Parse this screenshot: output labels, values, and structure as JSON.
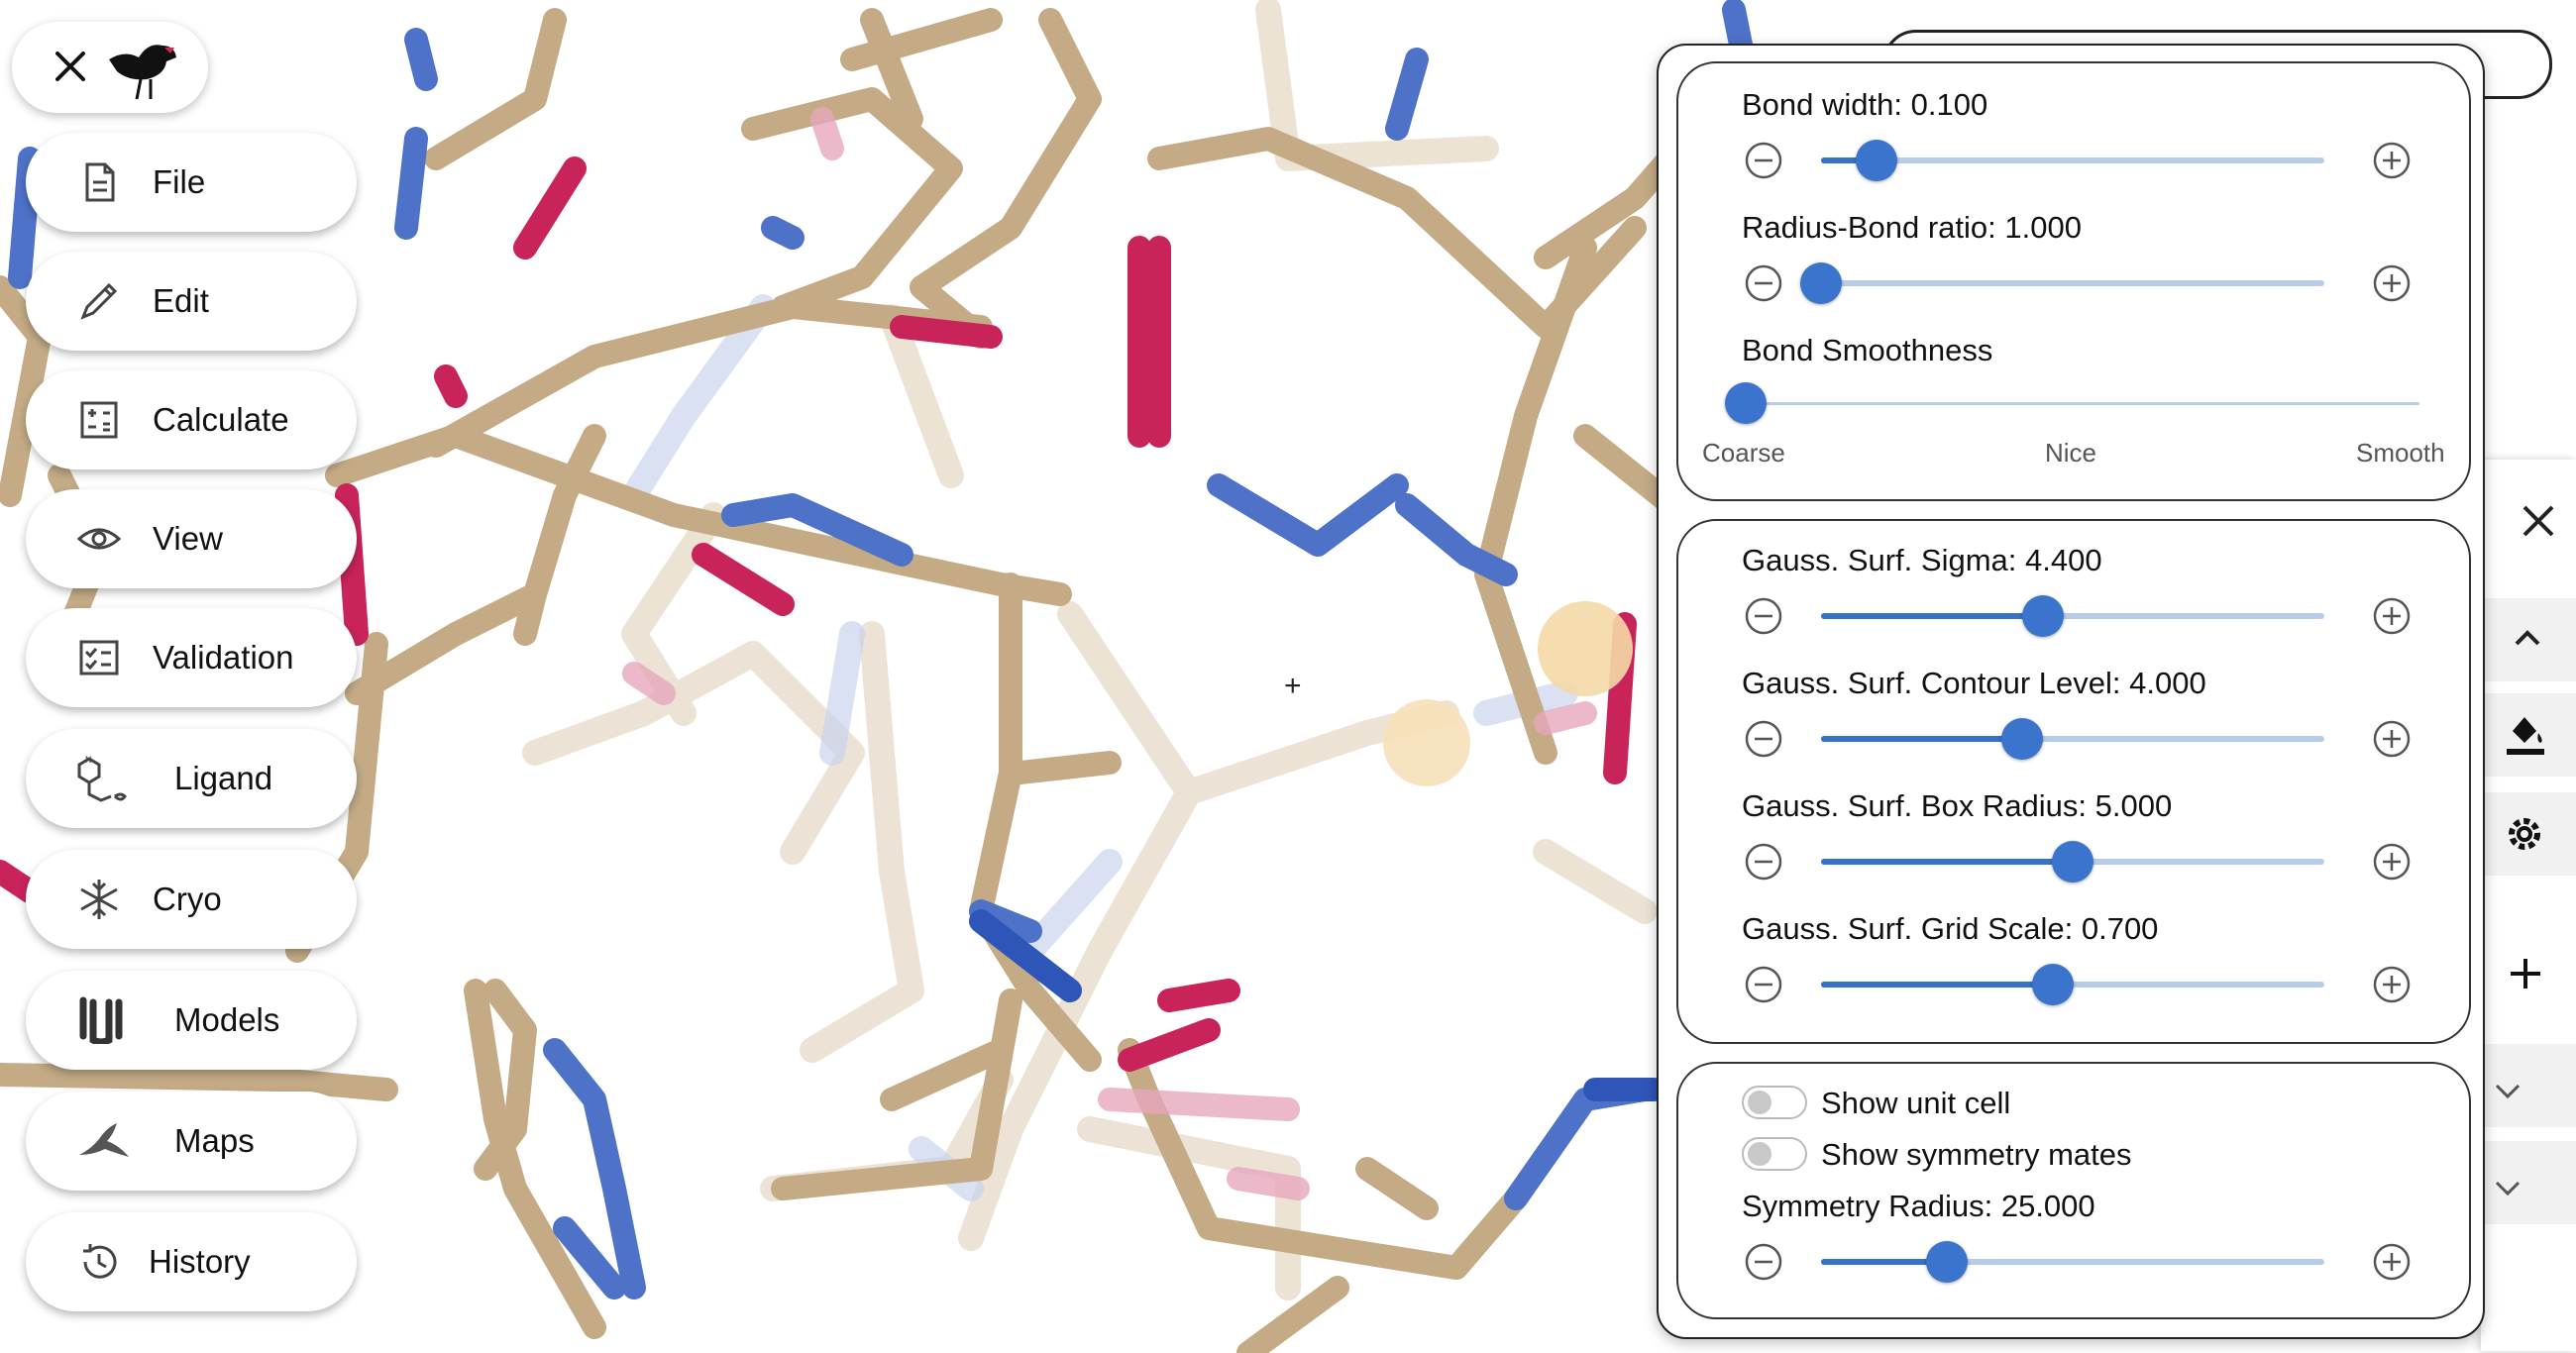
{
  "app": {
    "crosshair": "+"
  },
  "menu": [
    {
      "label": "File",
      "icon": "file-icon"
    },
    {
      "label": "Edit",
      "icon": "pencil-icon"
    },
    {
      "label": "Calculate",
      "icon": "calculator-icon"
    },
    {
      "label": "View",
      "icon": "eye-icon"
    },
    {
      "label": "Validation",
      "icon": "checklist-icon"
    },
    {
      "label": "Ligand",
      "icon": "ligand-icon"
    },
    {
      "label": "Cryo",
      "icon": "snowflake-icon"
    },
    {
      "label": "Models",
      "icon": "models-icon"
    },
    {
      "label": "Maps",
      "icon": "maps-icon"
    },
    {
      "label": "History",
      "icon": "history-icon"
    }
  ],
  "settings": {
    "bond_width": {
      "label": "Bond width: 0.100",
      "value": 0.1
    },
    "radius_bond_ratio": {
      "label": "Radius-Bond ratio: 1.000",
      "value": 1.0
    },
    "bond_smoothness": {
      "label": "Bond Smoothness",
      "ticks": [
        "Coarse",
        "Nice",
        "Smooth"
      ],
      "selected": "Coarse"
    },
    "gauss_sigma": {
      "label": "Gauss. Surf. Sigma: 4.400",
      "value": 4.4
    },
    "gauss_contour": {
      "label": "Gauss. Surf. Contour Level: 4.000",
      "value": 4.0
    },
    "gauss_box_radius": {
      "label": "Gauss. Surf. Box Radius: 5.000",
      "value": 5.0
    },
    "gauss_grid_scale": {
      "label": "Gauss. Surf. Grid Scale: 0.700",
      "value": 0.7
    },
    "show_unit_cell": {
      "label": "Show unit cell",
      "checked": false
    },
    "show_symmetry_mates": {
      "label": "Show symmetry mates",
      "checked": false
    },
    "symmetry_radius": {
      "label": "Symmetry Radius: 25.000",
      "value": 25.0
    }
  },
  "slider_fill": {
    "bond_width": 0.11,
    "radius_bond_ratio": 0.0,
    "bond_smoothness": 0.0,
    "gauss_sigma": 0.44,
    "gauss_contour": 0.4,
    "gauss_box_radius": 0.5,
    "gauss_grid_scale": 0.46,
    "symmetry_radius": 0.25
  },
  "colors": {
    "carbon": "#c8b08a",
    "nitrogen": "#4f72c9",
    "oxygen": "#c8245a",
    "slider": "#3a74cc",
    "slider_track": "#b6cce9"
  }
}
